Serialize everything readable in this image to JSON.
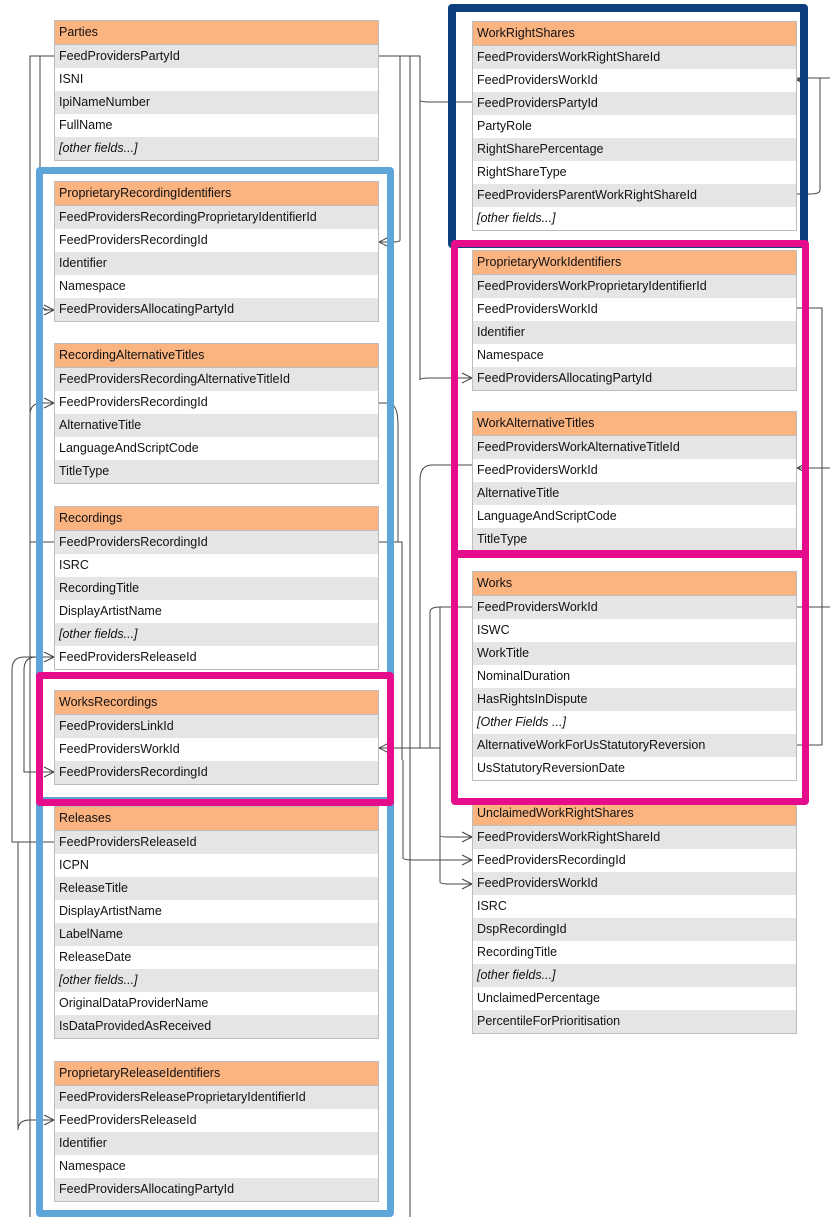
{
  "highlight_colors": {
    "recording_group": "#5ea5d9",
    "work_group": "#e60d8c",
    "work_right_shares": "#0e3e7e",
    "table_header": "#fbb380"
  },
  "tables": [
    {
      "name": "Parties",
      "fields": [
        {
          "label": "FeedProvidersPartyId"
        },
        {
          "label": "ISNI"
        },
        {
          "label": "IpiNameNumber"
        },
        {
          "label": "FullName"
        },
        {
          "label": "[other fields...]",
          "italic": true
        }
      ]
    },
    {
      "name": "ProprietaryRecordingIdentifiers",
      "fields": [
        {
          "label": "FeedProvidersRecordingProprietaryIdentifierId"
        },
        {
          "label": "FeedProvidersRecordingId"
        },
        {
          "label": "Identifier"
        },
        {
          "label": "Namespace"
        },
        {
          "label": "FeedProvidersAllocatingPartyId"
        }
      ]
    },
    {
      "name": "RecordingAlternativeTitles",
      "fields": [
        {
          "label": "FeedProvidersRecordingAlternativeTitleId"
        },
        {
          "label": "FeedProvidersRecordingId"
        },
        {
          "label": "AlternativeTitle"
        },
        {
          "label": "LanguageAndScriptCode"
        },
        {
          "label": "TitleType"
        }
      ]
    },
    {
      "name": "Recordings",
      "fields": [
        {
          "label": "FeedProvidersRecordingId"
        },
        {
          "label": "ISRC"
        },
        {
          "label": "RecordingTitle"
        },
        {
          "label": "DisplayArtistName"
        },
        {
          "label": "[other fields...]",
          "italic": true
        },
        {
          "label": "FeedProvidersReleaseId"
        }
      ]
    },
    {
      "name": "WorksRecordings",
      "fields": [
        {
          "label": "FeedProvidersLinkId"
        },
        {
          "label": "FeedProvidersWorkId"
        },
        {
          "label": "FeedProvidersRecordingId"
        }
      ]
    },
    {
      "name": "Releases",
      "fields": [
        {
          "label": "FeedProvidersReleaseId"
        },
        {
          "label": "ICPN"
        },
        {
          "label": "ReleaseTitle"
        },
        {
          "label": "DisplayArtistName"
        },
        {
          "label": "LabelName"
        },
        {
          "label": "ReleaseDate"
        },
        {
          "label": "[other fields...]",
          "italic": true
        },
        {
          "label": "OriginalDataProviderName"
        },
        {
          "label": "IsDataProvidedAsReceived"
        }
      ]
    },
    {
      "name": "ProprietaryReleaseIdentifiers",
      "fields": [
        {
          "label": "FeedProvidersReleaseProprietaryIdentifierId"
        },
        {
          "label": "FeedProvidersReleaseId"
        },
        {
          "label": "Identifier"
        },
        {
          "label": "Namespace"
        },
        {
          "label": "FeedProvidersAllocatingPartyId"
        }
      ]
    },
    {
      "name": "WorkRightShares",
      "fields": [
        {
          "label": "FeedProvidersWorkRightShareId"
        },
        {
          "label": "FeedProvidersWorkId"
        },
        {
          "label": "FeedProvidersPartyId"
        },
        {
          "label": "PartyRole"
        },
        {
          "label": "RightSharePercentage"
        },
        {
          "label": "RightShareType"
        },
        {
          "label": "FeedProvidersParentWorkRightShareId"
        },
        {
          "label": "[other fields...]",
          "italic": true
        }
      ]
    },
    {
      "name": "ProprietaryWorkIdentifiers",
      "fields": [
        {
          "label": "FeedProvidersWorkProprietaryIdentifierId"
        },
        {
          "label": "FeedProvidersWorkId"
        },
        {
          "label": "Identifier"
        },
        {
          "label": "Namespace"
        },
        {
          "label": "FeedProvidersAllocatingPartyId"
        }
      ]
    },
    {
      "name": "WorkAlternativeTitles",
      "fields": [
        {
          "label": "FeedProvidersWorkAlternativeTitleId"
        },
        {
          "label": "FeedProvidersWorkId"
        },
        {
          "label": "AlternativeTitle"
        },
        {
          "label": "LanguageAndScriptCode"
        },
        {
          "label": "TitleType"
        }
      ]
    },
    {
      "name": "Works",
      "fields": [
        {
          "label": "FeedProvidersWorkId"
        },
        {
          "label": "ISWC"
        },
        {
          "label": "WorkTitle"
        },
        {
          "label": "NominalDuration"
        },
        {
          "label": "HasRightsInDispute"
        },
        {
          "label": "[Other Fields ...]",
          "italic": true
        },
        {
          "label": "AlternativeWorkForUsStatutoryReversion"
        },
        {
          "label": "UsStatutoryReversionDate"
        }
      ]
    },
    {
      "name": "UnclaimedWorkRightShares",
      "fields": [
        {
          "label": "FeedProvidersWorkRightShareId"
        },
        {
          "label": "FeedProvidersRecordingId"
        },
        {
          "label": "FeedProvidersWorkId"
        },
        {
          "label": "ISRC"
        },
        {
          "label": "DspRecordingId"
        },
        {
          "label": "RecordingTitle"
        },
        {
          "label": "[other fields...]",
          "italic": true
        },
        {
          "label": "UnclaimedPercentage"
        },
        {
          "label": "PercentileForPrioritisation"
        }
      ]
    }
  ]
}
